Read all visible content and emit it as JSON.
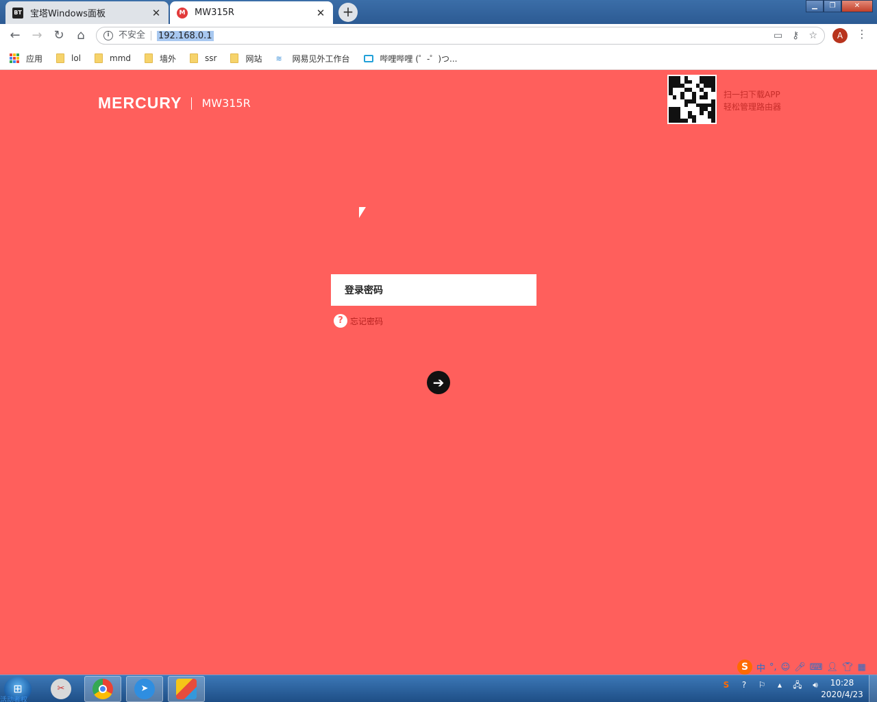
{
  "browser": {
    "tabs": [
      {
        "title": "宝塔Windows面板",
        "favicon": "BT",
        "active": false
      },
      {
        "title": "MW315R",
        "favicon": "M",
        "active": true
      }
    ],
    "new_tab_icon": "plus-icon",
    "address": {
      "security_label": "不安全",
      "url": "192.168.0.1"
    },
    "profile_initial": "A",
    "bookmarks": [
      {
        "label": "应用",
        "icon": "apps-grid-icon"
      },
      {
        "label": "lol",
        "icon": "folder-icon"
      },
      {
        "label": "mmd",
        "icon": "folder-icon"
      },
      {
        "label": "墙外",
        "icon": "folder-icon"
      },
      {
        "label": "ssr",
        "icon": "folder-icon"
      },
      {
        "label": "网站",
        "icon": "folder-icon"
      },
      {
        "label": "网易见外工作台",
        "icon": "bird-icon"
      },
      {
        "label": "哔哩哔哩 (゜-゜)つ...",
        "icon": "bilibili-tv-icon"
      }
    ]
  },
  "page": {
    "brand": "MERCURY",
    "model": "MW315R",
    "qr_text_line1": "扫一扫下载APP",
    "qr_text_line2": "轻松管理路由器",
    "password_placeholder": "登录密码",
    "forgot_label": "忘记密码",
    "background_color": "#ff5f5c"
  },
  "ime": {
    "mode": "中",
    "punct": "°,"
  },
  "taskbar": {
    "start_label": "活动者权",
    "apps": [
      "sogou-app-icon",
      "chrome-icon",
      "feiyu-icon",
      "cube-app-icon"
    ],
    "clock_time": "10:28",
    "clock_date": "2020/4/23"
  }
}
